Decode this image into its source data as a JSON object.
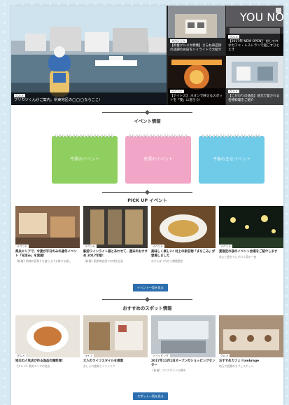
{
  "hero": {
    "main": {
      "tag": "グルメ",
      "caption": "ブリカツくんがご案内。県東地区の◯◯◯ならここ!"
    },
    "tiles": [
      {
        "tag": "スペシャル",
        "caption": "【新着グルメ大特集】さらね商店街の話題のお店をハイライトで大紹介"
      },
      {
        "tag": "グルメ",
        "caption": "【2017年 NEW OPEN】 おしゃれなカフェ・レストランで過ごすひととき"
      },
      {
        "tag": "イベント",
        "caption": "【ナイトス】 ネオンで映えるスポットを「夜」に巡ろう!"
      },
      {
        "tag": "グルメ",
        "caption": "【こだわりの逸品】地元で愛される名物料理をご紹介"
      }
    ],
    "overlay_text": "YOU NO"
  },
  "sections": {
    "event_calendar": "イベント情報",
    "pickup": "PICK UP イベント",
    "spots": "おすすめのスポット情報"
  },
  "calendar": [
    {
      "label": "今週のイベント",
      "color": "#8fcf5f"
    },
    {
      "label": "来週のイベント",
      "color": "#f1a6c8"
    },
    {
      "label": "今後の主なイベント",
      "color": "#6fcbe8"
    }
  ],
  "pickup": [
    {
      "tag": "イベント",
      "title": "県央エリアで、今夏が平日のみの通年イベント「光涼み」を実施!",
      "sub": "【新着】地域の夏祭りを盛り上げる様々な催し"
    },
    {
      "tag": "イベント",
      "title": "駅前ワインライト展とあわせて、週末のおすすめ 2017年版!",
      "sub": "【新着】駅前商店街での特別企画"
    },
    {
      "tag": "イベント",
      "title": "美味しく楽しい!  村上の新名物「まちこみ」が登場しました",
      "sub": "おさんぽ 7月から期間限定"
    },
    {
      "tag": "イベント",
      "title": "夏限定の夜のイベント会場をご紹介します",
      "sub": "花火と屋台でにぎわう夏の一夜"
    }
  ],
  "pickup_button": "イベント一覧を見る",
  "spots": [
    {
      "tag": "グルメ",
      "title": "地元の人気店が作る逸品の麺料理!",
      "sub": "【グルメ】県央エリアの名店"
    },
    {
      "tag": "ライフ",
      "title": "大人のライフスタイルを提案",
      "sub": "おしゃれ雑貨とインテリア"
    },
    {
      "tag": "ショッピング",
      "title": "2017年11月1日オープンのショッピングセンター",
      "sub": "【新着】フロアガイド公開中"
    },
    {
      "tag": "グルメ",
      "title": "おすすめカフェ l'ombrage",
      "sub": "地元で話題のカフェスポット"
    }
  ],
  "spots_button": "スポット一覧を見る"
}
